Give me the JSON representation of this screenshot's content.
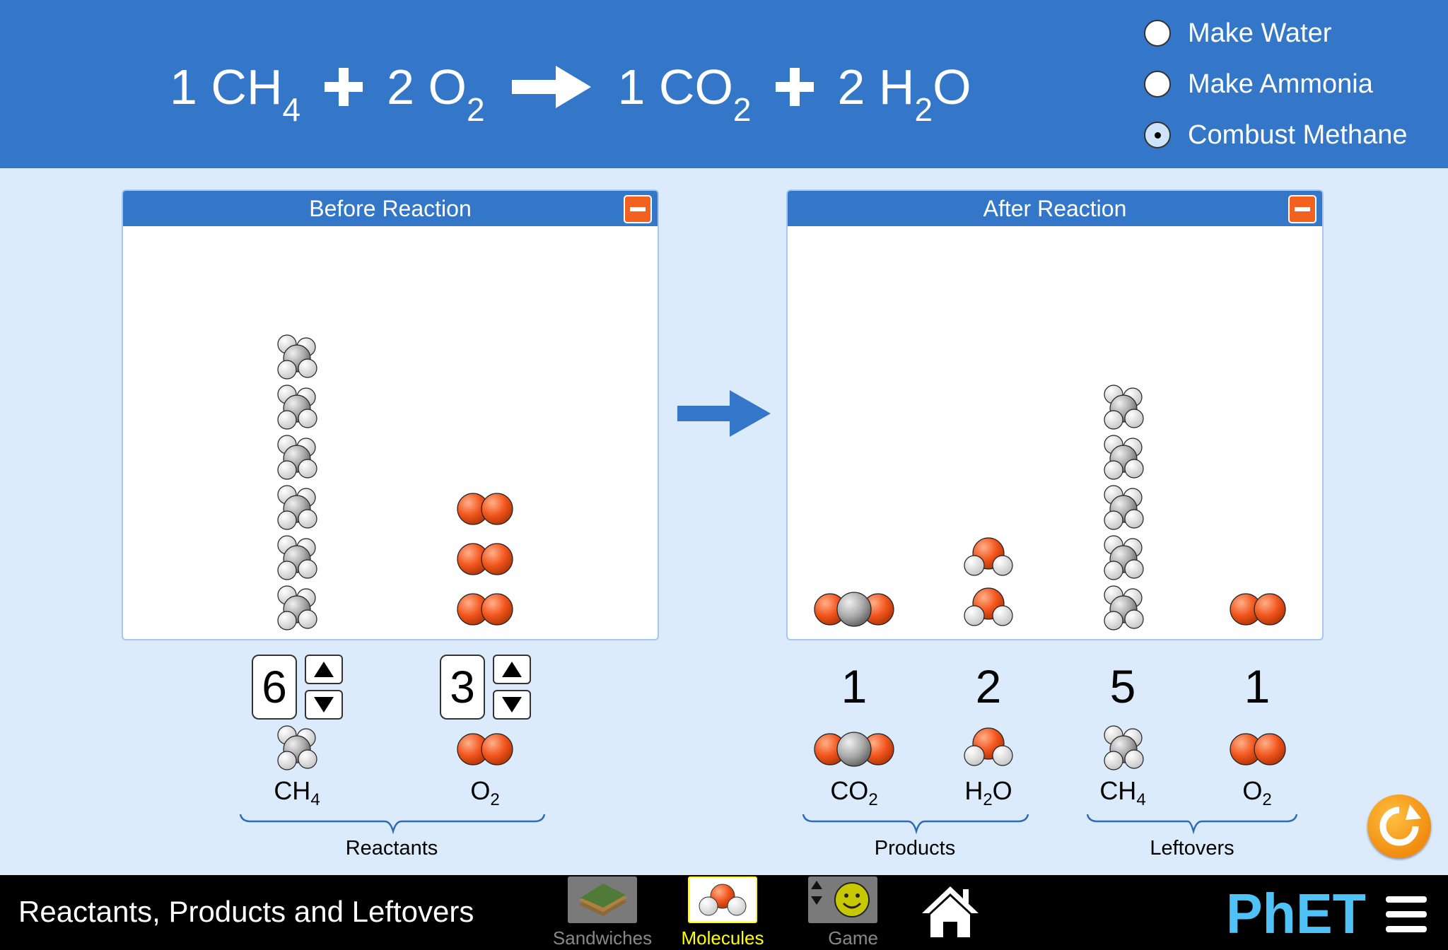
{
  "equation": {
    "terms": [
      {
        "coef": "1",
        "base": "CH",
        "sub": "4",
        "tail": ""
      },
      {
        "coef": "2",
        "base": "O",
        "sub": "2",
        "tail": ""
      },
      {
        "coef": "1",
        "base": "CO",
        "sub": "2",
        "tail": ""
      },
      {
        "coef": "2",
        "base": "H",
        "sub": "2",
        "tail": "O"
      }
    ]
  },
  "reactions": [
    {
      "label": "Make Water",
      "selected": false
    },
    {
      "label": "Make Ammonia",
      "selected": false
    },
    {
      "label": "Combust Methane",
      "selected": true
    }
  ],
  "before_box": {
    "title": "Before Reaction"
  },
  "after_box": {
    "title": "After Reaction"
  },
  "reactants": {
    "group_label": "Reactants",
    "items": [
      {
        "molecule": "CH4",
        "base": "CH",
        "sub": "4",
        "tail": "",
        "count": "6"
      },
      {
        "molecule": "O2",
        "base": "O",
        "sub": "2",
        "tail": "",
        "count": "3"
      }
    ]
  },
  "products": {
    "group_label": "Products",
    "items": [
      {
        "molecule": "CO2",
        "base": "CO",
        "sub": "2",
        "tail": "",
        "count": "1"
      },
      {
        "molecule": "H2O",
        "base": "H",
        "sub": "2",
        "tail": "O",
        "count": "2"
      }
    ]
  },
  "leftovers": {
    "group_label": "Leftovers",
    "items": [
      {
        "molecule": "CH4",
        "base": "CH",
        "sub": "4",
        "tail": "",
        "count": "5"
      },
      {
        "molecule": "O2",
        "base": "O",
        "sub": "2",
        "tail": "",
        "count": "1"
      }
    ]
  },
  "navbar": {
    "sim_title": "Reactants, Products and Leftovers",
    "screens": [
      {
        "label": "Sandwiches",
        "selected": false
      },
      {
        "label": "Molecules",
        "selected": true
      },
      {
        "label": "Game",
        "selected": false
      }
    ],
    "brand": "PhET"
  },
  "colors": {
    "header_bg": "#3477c8",
    "panel_bg": "#dcebfc",
    "oxygen": "#f2541c",
    "carbon": "#aaaaaa",
    "hydrogen": "#ffffff",
    "selected_screen_label": "#ffff00",
    "unselected_screen_label": "#888888",
    "reset_button": "#f08c10"
  },
  "icons": [
    "minus-icon",
    "arrow-right-icon",
    "arrow-up-icon",
    "arrow-down-icon",
    "reset-icon",
    "home-icon",
    "menu-icon"
  ]
}
